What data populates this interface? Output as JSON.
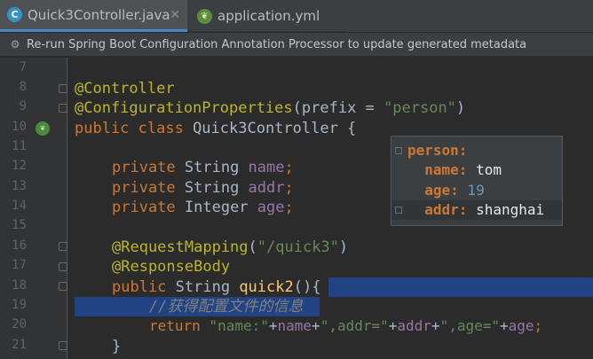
{
  "tabs": [
    {
      "label": "Quick3Controller.java",
      "icon": "c",
      "active": true
    },
    {
      "label": "application.yml",
      "icon": "leaf",
      "active": false
    }
  ],
  "banner": {
    "text": "Re-run Spring Boot Configuration Annotation Processor to update generated metadata"
  },
  "editor": {
    "lines": [
      {
        "num": "7"
      },
      {
        "num": "8"
      },
      {
        "num": "9"
      },
      {
        "num": "10"
      },
      {
        "num": "11"
      },
      {
        "num": "12"
      },
      {
        "num": "13"
      },
      {
        "num": "14"
      },
      {
        "num": "15"
      },
      {
        "num": "16"
      },
      {
        "num": "17"
      },
      {
        "num": "18"
      },
      {
        "num": "19"
      },
      {
        "num": "20"
      },
      {
        "num": "21"
      }
    ],
    "code": {
      "l8_ann": "@Controller",
      "l9_ann": "@ConfigurationProperties",
      "l9_open": "(",
      "l9_param": "prefix",
      "l9_eq": " = ",
      "l9_str": "\"person\"",
      "l9_close": ")",
      "l10_kw": "public class ",
      "l10_name": "Quick3Controller {",
      "l12_kw": "private ",
      "l12_type": "String ",
      "l12_field": "name",
      "l12_end": ";",
      "l13_kw": "private ",
      "l13_type": "String ",
      "l13_field": "addr",
      "l13_end": ";",
      "l14_kw": "private ",
      "l14_type": "Integer ",
      "l14_field": "age",
      "l14_end": ";",
      "l16_ann": "@RequestMapping",
      "l16_open": "(",
      "l16_str": "\"/quick3\"",
      "l16_close": ")",
      "l17_ann": "@ResponseBody",
      "l18_kw": "public ",
      "l18_type": "String ",
      "l18_fn": "quick2",
      "l18_end": "(){",
      "l19_cmt": "//获得配置文件的信息",
      "l20_kw": "return ",
      "l20_s1": "\"name:\"",
      "l20_p1": "+",
      "l20_f1": "name",
      "l20_p2": "+",
      "l20_s2": "\",addr=\"",
      "l20_p3": "+",
      "l20_f2": "addr",
      "l20_p4": "+",
      "l20_s3": "\",age=\"",
      "l20_p5": "+",
      "l20_f3": "age",
      "l20_end": ";",
      "l21_brace": "}"
    }
  },
  "popup": {
    "root_key": "person:",
    "name_key": "name:",
    "name_val": " tom",
    "age_key": "age:",
    "age_val": " 19",
    "addr_key": "addr:",
    "addr_val": " shanghai"
  },
  "colors": {
    "keyword": "#cc7832",
    "annotation": "#bbb529",
    "string": "#6a8759",
    "field": "#9876aa",
    "selection": "#214283",
    "background": "#2b2b2b"
  }
}
